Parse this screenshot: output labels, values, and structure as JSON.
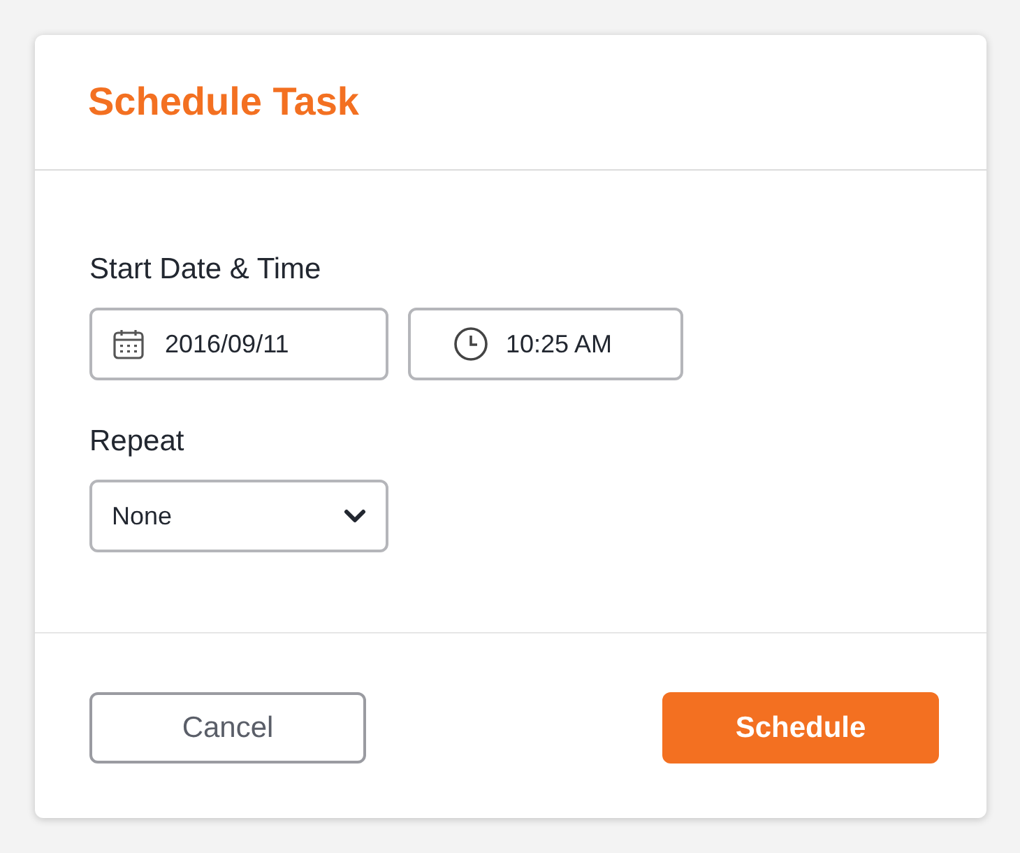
{
  "dialog": {
    "title": "Schedule Task"
  },
  "start": {
    "label": "Start Date & Time",
    "fields": [
      {
        "kind": "date",
        "value": "2016/09/11"
      },
      {
        "kind": "time",
        "value": "10:25 AM"
      }
    ]
  },
  "repeat": {
    "label": "Repeat",
    "value": "None"
  },
  "buttons": [
    {
      "kind": "secondary",
      "label": "Cancel"
    },
    {
      "kind": "primary",
      "label": "Schedule"
    }
  ]
}
